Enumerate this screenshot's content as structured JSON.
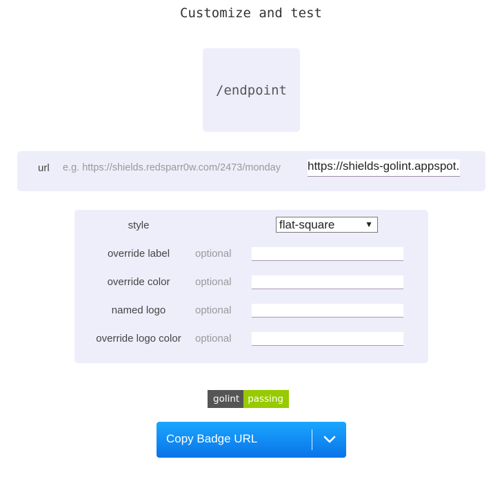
{
  "page": {
    "title": "Customize and test"
  },
  "endpoint": {
    "path": "/endpoint"
  },
  "url_field": {
    "label": "url",
    "hint": "e.g. https://shields.redsparr0w.com/2473/monday",
    "value": "https://shields-golint.appspot.com/"
  },
  "options": {
    "style": {
      "label": "style",
      "selected": "flat-square"
    },
    "rows": [
      {
        "label": "override label",
        "placeholder": "optional",
        "value": ""
      },
      {
        "label": "override color",
        "placeholder": "optional",
        "value": ""
      },
      {
        "label": "named logo",
        "placeholder": "optional",
        "value": ""
      },
      {
        "label": "override logo color",
        "placeholder": "optional",
        "value": ""
      }
    ]
  },
  "badge": {
    "label": "golint",
    "message": "passing",
    "label_color": "#555555",
    "message_color": "#97ca00"
  },
  "copy_button": {
    "label": "Copy Badge URL",
    "icon": "chevron-down-icon"
  }
}
